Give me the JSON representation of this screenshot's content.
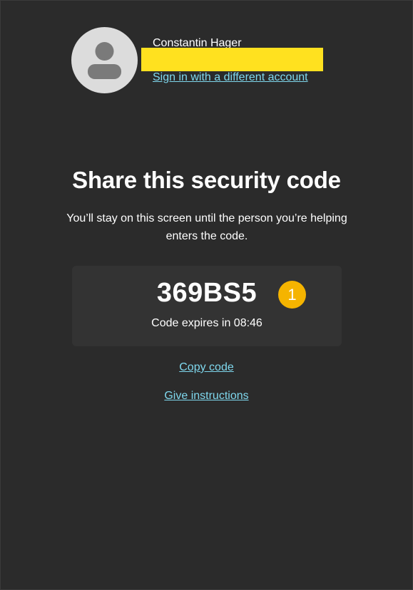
{
  "account": {
    "name": "Constantin Hager",
    "switch_link": "Sign in with a different account"
  },
  "main": {
    "title": "Share this security code",
    "description": "You’ll stay on this screen until the person you’re helping enters the code.",
    "code": "369BS5",
    "step_badge": "1",
    "expiry_text": "Code expires in 08:46",
    "copy_link": "Copy code",
    "instructions_link": "Give instructions"
  },
  "colors": {
    "background": "#2b2b2b",
    "card": "#333333",
    "link": "#7fd8ee",
    "badge": "#f5b400",
    "redaction": "#ffe11f",
    "avatar": "#dcdcdc"
  },
  "icons": {
    "avatar": "person-silhouette-icon"
  }
}
